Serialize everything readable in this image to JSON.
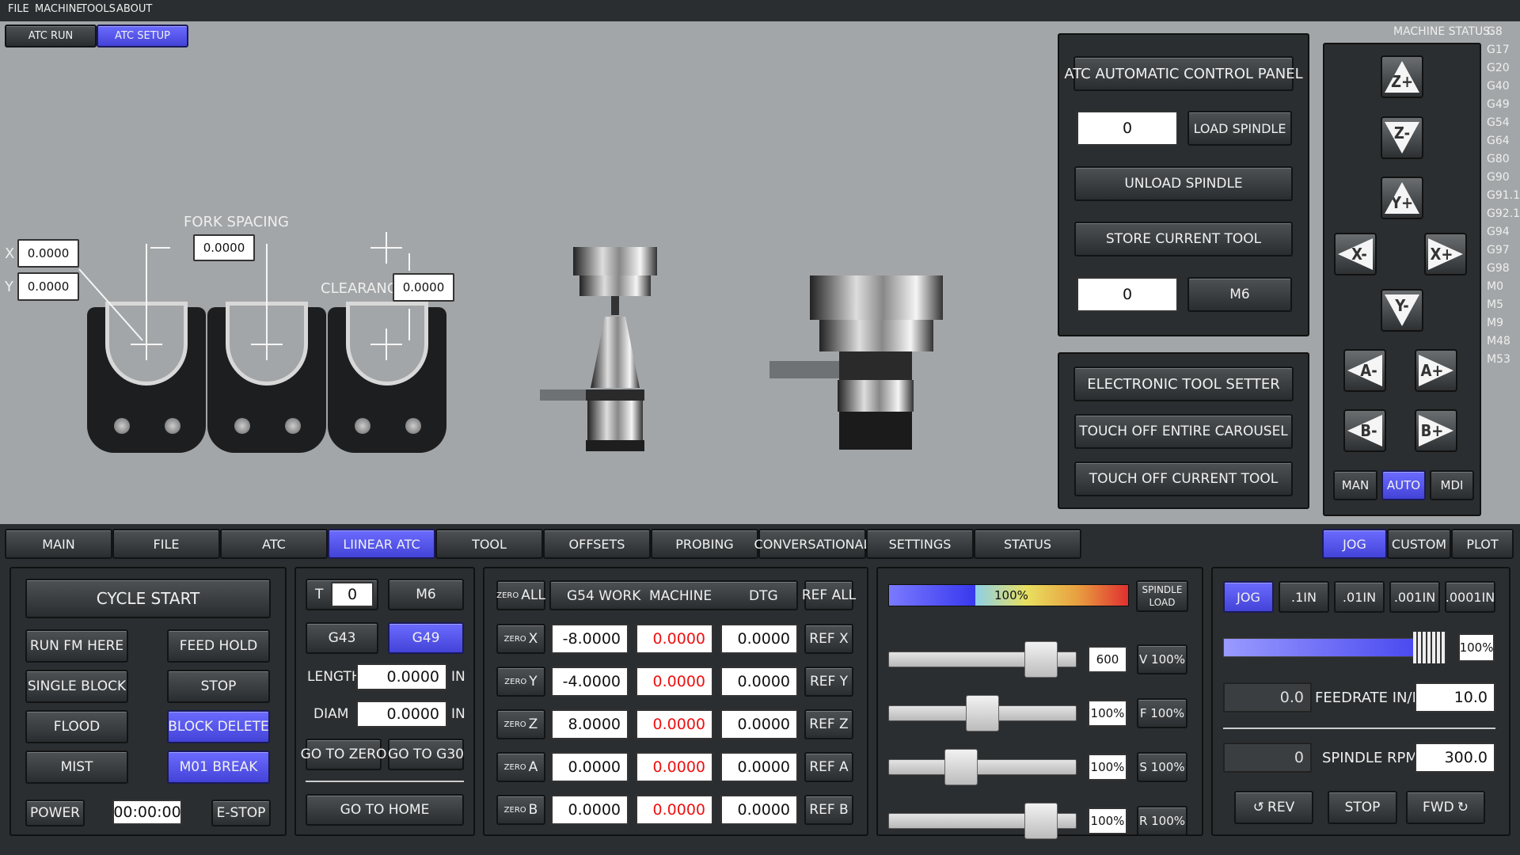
{
  "menu": [
    "FILE",
    "MACHINE",
    "TOOLS",
    "ABOUT"
  ],
  "top_tabs": [
    "ATC RUN",
    "ATC SETUP"
  ],
  "atc_setup": {
    "x_label": "X",
    "y_label": "Y",
    "x_value": "0.0000",
    "y_value": "0.0000",
    "fork_spacing_label": "FORK SPACING",
    "fork_spacing_value": "0.0000",
    "clearance_label": "CLEARANCE",
    "clearance_value": "0.0000"
  },
  "atc_panel": {
    "title": "ATC AUTOMATIC CONTROL PANEL",
    "tool_value": "0",
    "load_spindle": "LOAD SPINDLE",
    "unload_spindle": "UNLOAD SPINDLE",
    "store_current_tool": "STORE CURRENT TOOL",
    "m6_value": "0",
    "m6": "M6"
  },
  "tool_setter": {
    "title": "ELECTRONIC TOOL SETTER",
    "touch_off_carousel": "TOUCH OFF ENTIRE CAROUSEL",
    "touch_off_current": "TOUCH OFF CURRENT TOOL"
  },
  "machine_status": {
    "label": "MACHINE STATUS:",
    "codes": [
      "G8",
      "G17",
      "G20",
      "G40",
      "G49",
      "G54",
      "G64",
      "G80",
      "G90",
      "G91.1",
      "G92.1",
      "G94",
      "G97",
      "G98",
      "M0",
      "M5",
      "M9",
      "M48",
      "M53"
    ]
  },
  "jog_buttons": {
    "zp": "Z+",
    "zm": "Z-",
    "yp": "Y+",
    "xm": "X-",
    "xp": "X+",
    "ym": "Y-",
    "am": "A-",
    "ap": "A+",
    "bm": "B-",
    "bp": "B+"
  },
  "modes": [
    "MAN",
    "AUTO",
    "MDI"
  ],
  "main_tabs": [
    "MAIN",
    "FILE",
    "ATC",
    "LIINEAR ATC",
    "TOOL",
    "OFFSETS",
    "PROBING",
    "CONVERSATIONAL",
    "SETTINGS",
    "STATUS"
  ],
  "right_tabs": [
    "JOG",
    "CUSTOM",
    "PLOT"
  ],
  "cycle": {
    "cycle_start": "CYCLE START",
    "run_fm_here": "RUN FM HERE",
    "feed_hold": "FEED HOLD",
    "single_block": "SINGLE BLOCK",
    "stop": "STOP",
    "flood": "FLOOD",
    "block_delete": "BLOCK DELETE",
    "mist": "MIST",
    "m01_break": "M01 BREAK",
    "power": "POWER",
    "timer": "00:00:00",
    "estop": "E-STOP"
  },
  "tool": {
    "t_label": "T",
    "t_value": "0",
    "m6": "M6",
    "g43": "G43",
    "g49": "G49",
    "length_label": "LENGTH",
    "length_value": "0.0000",
    "diam_label": "DIAM",
    "diam_value": "0.0000",
    "unit": "IN",
    "go_to_zero": "GO TO ZERO",
    "go_to_g30": "GO TO G30",
    "go_to_home": "GO TO HOME"
  },
  "dro": {
    "zero_all_small": "ZERO",
    "zero_all_big": "ALL",
    "headers": [
      "G54 WORK",
      "MACHINE",
      "DTG"
    ],
    "ref_all": "REF ALL",
    "zero_small": "ZERO",
    "rows": [
      {
        "axis": "X",
        "work": "-8.0000",
        "machine": "0.0000",
        "dtg": "0.0000",
        "ref": "REF X"
      },
      {
        "axis": "Y",
        "work": "-4.0000",
        "machine": "0.0000",
        "dtg": "0.0000",
        "ref": "REF Y"
      },
      {
        "axis": "Z",
        "work": "8.0000",
        "machine": "0.0000",
        "dtg": "0.0000",
        "ref": "REF Z"
      },
      {
        "axis": "A",
        "work": "0.0000",
        "machine": "0.0000",
        "dtg": "0.0000",
        "ref": "REF A"
      },
      {
        "axis": "B",
        "work": "0.0000",
        "machine": "0.0000",
        "dtg": "0.0000",
        "ref": "REF B"
      }
    ]
  },
  "overrides": {
    "spindle_load_pct": "100%",
    "spindle_load_fraction": 0.65,
    "spindle_load_label_1": "SPINDLE",
    "spindle_load_label_2": "LOAD",
    "rows": [
      {
        "value": "600",
        "button": "V 100%",
        "slider": 0.88
      },
      {
        "value": "100%",
        "button": "F 100%",
        "slider": 0.5
      },
      {
        "value": "100%",
        "button": "S 100%",
        "slider": 0.36
      },
      {
        "value": "100%",
        "button": "R 100%",
        "slider": 0.88
      }
    ]
  },
  "jog": {
    "increments": [
      "JOG",
      ".1IN",
      ".01IN",
      ".001IN",
      ".0001IN"
    ],
    "speed_pct": "100%",
    "speed_fraction": 0.86,
    "feed_actual": "0.0",
    "feed_label": "FEEDRATE IN/M",
    "feed_value": "10.0",
    "rpm_actual": "0",
    "rpm_label": "SPINDLE RPM",
    "rpm_value": "300.0",
    "rev": "REV",
    "stop": "STOP",
    "fwd": "FWD"
  }
}
